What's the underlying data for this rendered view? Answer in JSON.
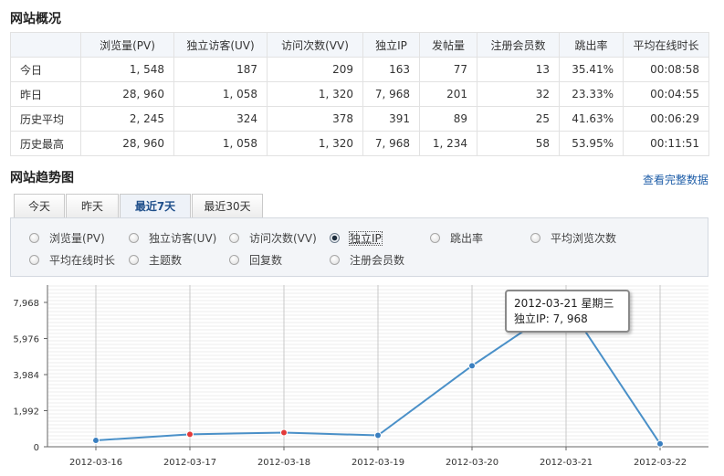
{
  "overview": {
    "title": "网站概况",
    "headers": [
      "",
      "浏览量(PV)",
      "独立访客(UV)",
      "访问次数(VV)",
      "独立IP",
      "发帖量",
      "注册会员数",
      "跳出率",
      "平均在线时长"
    ],
    "rows": [
      [
        "今日",
        "1, 548",
        "187",
        "209",
        "163",
        "77",
        "13",
        "35.41%",
        "00:08:58"
      ],
      [
        "昨日",
        "28, 960",
        "1, 058",
        "1, 320",
        "7, 968",
        "201",
        "32",
        "23.33%",
        "00:04:55"
      ],
      [
        "历史平均",
        "2, 245",
        "324",
        "378",
        "391",
        "89",
        "25",
        "41.63%",
        "00:06:29"
      ],
      [
        "历史最高",
        "28, 960",
        "1, 058",
        "1, 320",
        "7, 968",
        "1, 234",
        "58",
        "53.95%",
        "00:11:51"
      ]
    ]
  },
  "trend": {
    "title": "网站趋势图",
    "full_data_link": "查看完整数据",
    "tabs": [
      {
        "label": "今天",
        "active": false
      },
      {
        "label": "昨天",
        "active": false
      },
      {
        "label": "最近7天",
        "active": true
      },
      {
        "label": "最近30天",
        "active": false
      }
    ],
    "metrics": [
      {
        "label": "浏览量(PV)",
        "checked": false
      },
      {
        "label": "独立访客(UV)",
        "checked": false
      },
      {
        "label": "访问次数(VV)",
        "checked": false
      },
      {
        "label": "独立IP",
        "checked": true
      },
      {
        "label": "跳出率",
        "checked": false
      },
      {
        "label": "平均浏览次数",
        "checked": false
      },
      {
        "label": "平均在线时长",
        "checked": false
      },
      {
        "label": "主题数",
        "checked": false
      },
      {
        "label": "回复数",
        "checked": false
      },
      {
        "label": "注册会员数",
        "checked": false
      }
    ],
    "tooltip": {
      "line1": "2012-03-21 星期三",
      "line2": "独立IP: 7, 968"
    }
  },
  "colors": {
    "line": "#4a90c8",
    "point": "#3a7fc0",
    "point_highlight": "#e23a3a",
    "link": "#1f5ea8"
  },
  "chart_data": {
    "type": "line",
    "x": [
      "2012-03-16",
      "2012-03-17",
      "2012-03-18",
      "2012-03-19",
      "2012-03-20",
      "2012-03-21",
      "2012-03-22"
    ],
    "series": [
      {
        "name": "独立IP",
        "values": [
          350,
          690,
          780,
          630,
          4470,
          7968,
          163
        ]
      }
    ],
    "highlighted_points": [
      1,
      2
    ],
    "ylim": [
      0,
      7968
    ],
    "yticks": [
      "7,968",
      "5,976",
      "3,984",
      "1,992",
      "0"
    ],
    "grid": true
  }
}
